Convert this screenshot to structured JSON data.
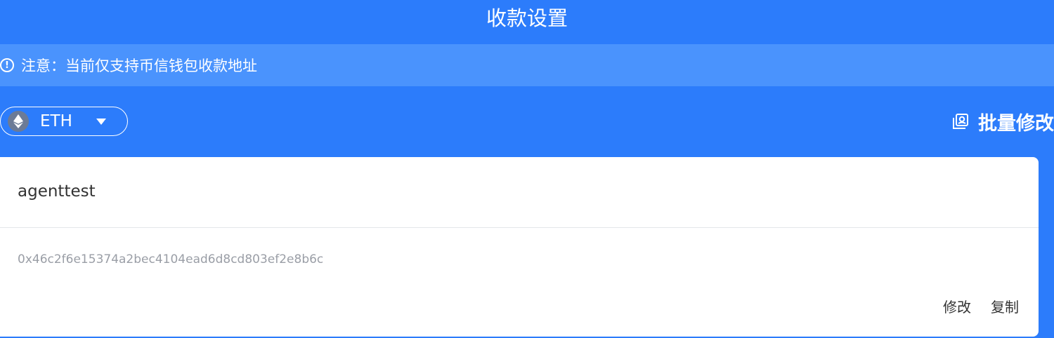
{
  "header": {
    "title": "收款设置"
  },
  "notice": {
    "icon": "exclamation-circle-icon",
    "text": "注意：当前仅支持币信钱包收款地址"
  },
  "coin_selector": {
    "icon": "ethereum-icon",
    "selected": "ETH"
  },
  "batch_edit": {
    "icon": "batch-edit-icon",
    "label": "批量修改"
  },
  "wallet_card": {
    "name": "agenttest",
    "address": "0x46c2f6e15374a2bec4104ead6d8cd803ef2e8b6c",
    "actions": {
      "edit_label": "修改",
      "copy_label": "复制"
    }
  },
  "colors": {
    "primary": "#2c7cfb",
    "notice_bg": "#4a93fd",
    "card_bg": "#ffffff",
    "address_text": "#9a9ea6"
  }
}
